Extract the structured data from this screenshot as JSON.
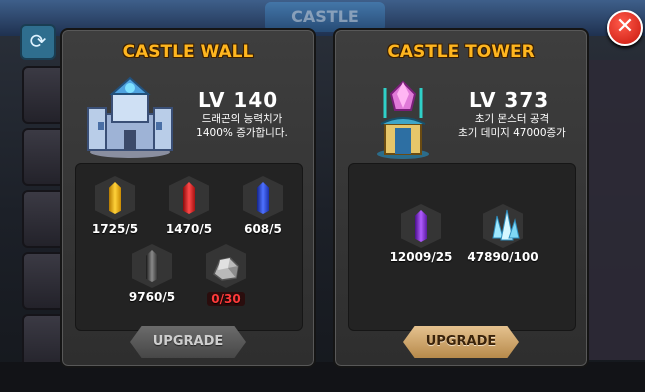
{
  "background": {
    "title": "CASTLE"
  },
  "castle_wall": {
    "title": "CASTLE WALL",
    "level": "LV 140",
    "description": "드래곤의 능력치가\n1400% 증가합니다.",
    "materials": [
      {
        "icon": "yellow-crystal-icon",
        "qty": "1725/5"
      },
      {
        "icon": "red-crystal-icon",
        "qty": "1470/5"
      },
      {
        "icon": "blue-crystal-icon",
        "qty": "608/5"
      },
      {
        "icon": "black-crystal-icon",
        "qty": "9760/5"
      },
      {
        "icon": "stone-ore-icon",
        "qty": "0/30"
      }
    ],
    "upgrade_label": "UPGRADE"
  },
  "castle_tower": {
    "title": "CASTLE TOWER",
    "level": "LV 373",
    "description": "초기 몬스터 공격\n초기 데미지 47000증가",
    "materials": [
      {
        "icon": "purple-crystal-icon",
        "qty": "12009/25"
      },
      {
        "icon": "ice-crystal-cluster-icon",
        "qty": "47890/100"
      }
    ],
    "upgrade_label": "UPGRADE"
  },
  "colors": {
    "title_orange": "#ffb61f",
    "insufficient_red": "#ff3a3a",
    "upgrade_active": "#d4a866",
    "upgrade_disabled": "#5a5a5a"
  }
}
